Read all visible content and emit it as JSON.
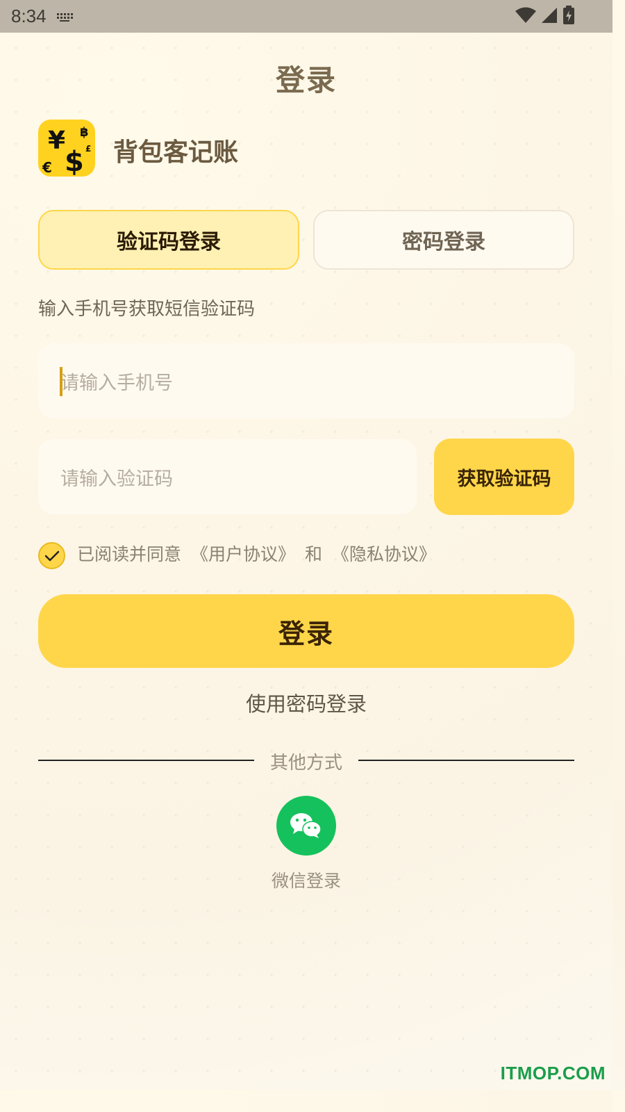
{
  "status_bar": {
    "time": "8:34"
  },
  "header": {
    "title": "登录"
  },
  "app": {
    "name": "背包客记账"
  },
  "tabs": {
    "sms_login": "验证码登录",
    "password_login": "密码登录"
  },
  "form": {
    "hint": "输入手机号获取短信验证码",
    "phone_placeholder": "请输入手机号",
    "code_placeholder": "请输入验证码",
    "get_code_label": "获取验证码"
  },
  "agreement": {
    "prefix": "已阅读并同意",
    "user_agreement": "《用户协议》",
    "and": "和",
    "privacy_agreement": "《隐私协议》",
    "checked": true
  },
  "actions": {
    "login_label": "登录",
    "use_password_label": "使用密码登录"
  },
  "other": {
    "divider_label": "其他方式",
    "wechat_label": "微信登录"
  },
  "watermark": "ITMOP.COM",
  "colors": {
    "accent": "#ffd64a",
    "wechat": "#15c15c"
  }
}
